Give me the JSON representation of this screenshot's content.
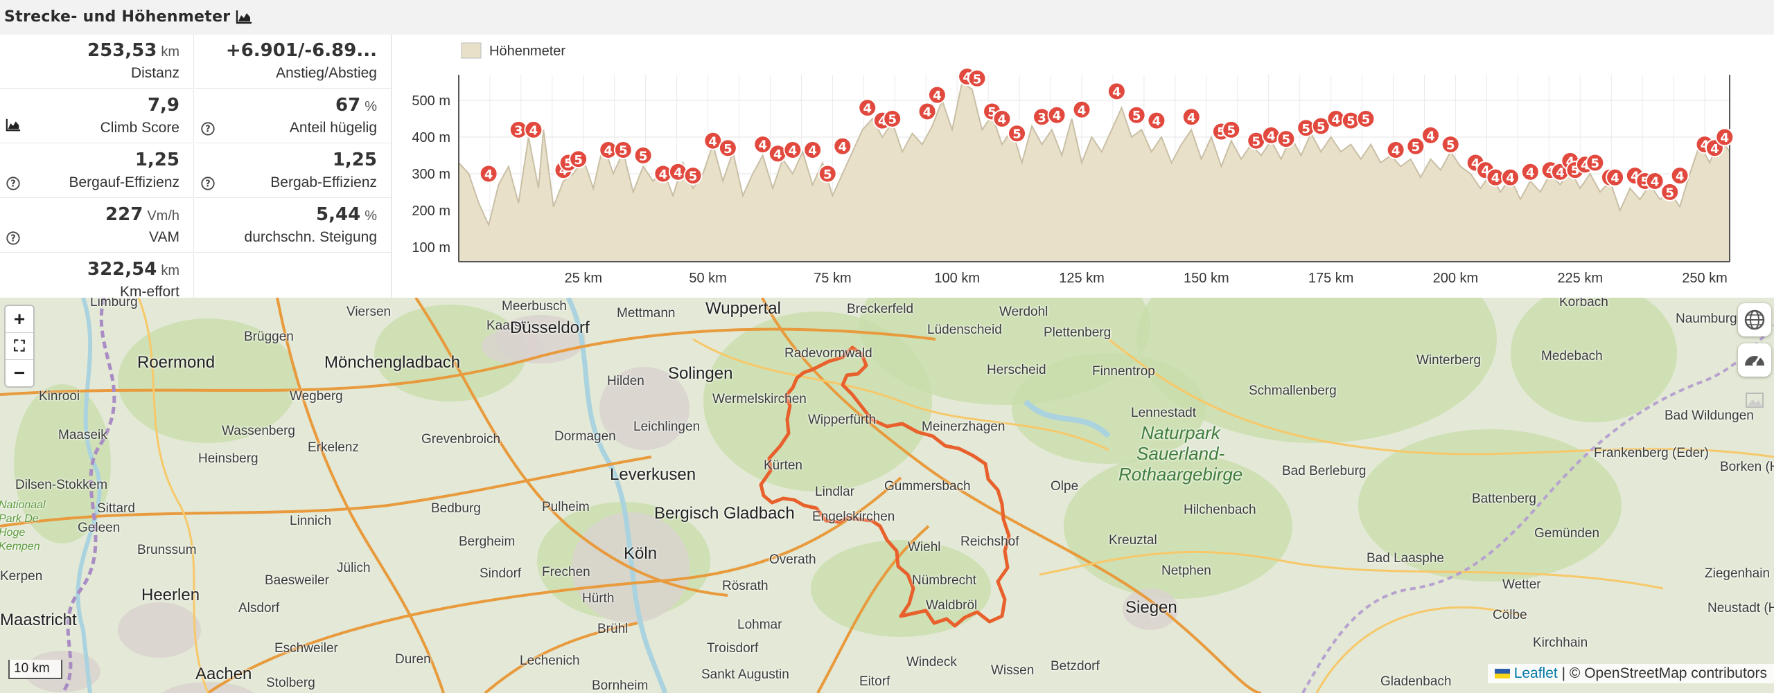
{
  "section_title": "Strecke- und Höhenmeter",
  "stats": [
    {
      "num": "253,53",
      "unit": "km",
      "label": "Distanz",
      "icon": ""
    },
    {
      "num": "+6.901/-6.89...",
      "unit": "",
      "label": "Anstieg/Abstieg",
      "icon": ""
    },
    {
      "num": "7,9",
      "unit": "",
      "label": "Climb Score",
      "icon": "chart-icon"
    },
    {
      "num": "67",
      "unit": "%",
      "label": "Anteil hügelig",
      "icon": "help-icon"
    },
    {
      "num": "1,25",
      "unit": "",
      "label": "Bergauf-Effizienz",
      "icon": "help-icon"
    },
    {
      "num": "1,25",
      "unit": "",
      "label": "Bergab-Effizienz",
      "icon": "help-icon"
    },
    {
      "num": "227",
      "unit": "Vm/h",
      "label": "VAM",
      "icon": "help-icon"
    },
    {
      "num": "5,44",
      "unit": "%",
      "label": "durchschn. Steigung",
      "icon": ""
    },
    {
      "num": "322,54",
      "unit": "km",
      "label": "Km-effort",
      "icon": ""
    }
  ],
  "chart_data": {
    "type": "area",
    "legend": "Höhenmeter",
    "legend_position": "top-left",
    "ylim": [
      60,
      570
    ],
    "xlim": [
      0,
      255
    ],
    "y_ticks": [
      100,
      200,
      300,
      400,
      500
    ],
    "y_tick_labels": [
      "100 m",
      "200 m",
      "300 m",
      "400 m",
      "500 m"
    ],
    "x_ticks": [
      25,
      50,
      75,
      100,
      125,
      150,
      175,
      200,
      225,
      250
    ],
    "x_tick_labels": [
      "25 km",
      "50 km",
      "75 km",
      "100 km",
      "125 km",
      "150 km",
      "175 km",
      "200 km",
      "225 km",
      "250 km"
    ],
    "grid": true,
    "fill_color": "#e8e0c9",
    "line_color": "#c9bfa5",
    "profile": [
      [
        0,
        330
      ],
      [
        2,
        300
      ],
      [
        4,
        220
      ],
      [
        6,
        160
      ],
      [
        8,
        270
      ],
      [
        10,
        320
      ],
      [
        12,
        220
      ],
      [
        14,
        400
      ],
      [
        16,
        260
      ],
      [
        17,
        420
      ],
      [
        19,
        210
      ],
      [
        21,
        280
      ],
      [
        23,
        300
      ],
      [
        25,
        340
      ],
      [
        27,
        260
      ],
      [
        29,
        380
      ],
      [
        31,
        300
      ],
      [
        33,
        360
      ],
      [
        35,
        250
      ],
      [
        37,
        320
      ],
      [
        39,
        280
      ],
      [
        41,
        310
      ],
      [
        43,
        240
      ],
      [
        45,
        330
      ],
      [
        47,
        260
      ],
      [
        49,
        300
      ],
      [
        51,
        380
      ],
      [
        53,
        280
      ],
      [
        55,
        360
      ],
      [
        57,
        240
      ],
      [
        59,
        300
      ],
      [
        61,
        350
      ],
      [
        63,
        260
      ],
      [
        65,
        340
      ],
      [
        67,
        300
      ],
      [
        69,
        360
      ],
      [
        71,
        270
      ],
      [
        73,
        330
      ],
      [
        75,
        240
      ],
      [
        77,
        300
      ],
      [
        79,
        360
      ],
      [
        81,
        420
      ],
      [
        83,
        450
      ],
      [
        85,
        400
      ],
      [
        87,
        440
      ],
      [
        89,
        360
      ],
      [
        91,
        410
      ],
      [
        93,
        380
      ],
      [
        95,
        430
      ],
      [
        97,
        500
      ],
      [
        99,
        420
      ],
      [
        101,
        550
      ],
      [
        103,
        530
      ],
      [
        105,
        420
      ],
      [
        107,
        460
      ],
      [
        109,
        380
      ],
      [
        111,
        420
      ],
      [
        113,
        330
      ],
      [
        115,
        430
      ],
      [
        117,
        380
      ],
      [
        119,
        420
      ],
      [
        121,
        350
      ],
      [
        123,
        450
      ],
      [
        125,
        330
      ],
      [
        127,
        400
      ],
      [
        129,
        360
      ],
      [
        131,
        420
      ],
      [
        133,
        480
      ],
      [
        135,
        400
      ],
      [
        137,
        420
      ],
      [
        139,
        360
      ],
      [
        141,
        400
      ],
      [
        143,
        330
      ],
      [
        145,
        380
      ],
      [
        147,
        420
      ],
      [
        149,
        340
      ],
      [
        151,
        400
      ],
      [
        153,
        320
      ],
      [
        155,
        390
      ],
      [
        157,
        340
      ],
      [
        159,
        380
      ],
      [
        161,
        350
      ],
      [
        163,
        390
      ],
      [
        165,
        340
      ],
      [
        167,
        400
      ],
      [
        169,
        350
      ],
      [
        171,
        410
      ],
      [
        173,
        360
      ],
      [
        175,
        400
      ],
      [
        177,
        360
      ],
      [
        179,
        380
      ],
      [
        181,
        340
      ],
      [
        183,
        380
      ],
      [
        185,
        330
      ],
      [
        187,
        350
      ],
      [
        189,
        320
      ],
      [
        191,
        340
      ],
      [
        193,
        290
      ],
      [
        195,
        340
      ],
      [
        197,
        310
      ],
      [
        199,
        360
      ],
      [
        201,
        320
      ],
      [
        203,
        300
      ],
      [
        205,
        260
      ],
      [
        207,
        300
      ],
      [
        209,
        250
      ],
      [
        211,
        290
      ],
      [
        213,
        230
      ],
      [
        215,
        280
      ],
      [
        217,
        250
      ],
      [
        219,
        300
      ],
      [
        221,
        270
      ],
      [
        223,
        310
      ],
      [
        225,
        260
      ],
      [
        227,
        300
      ],
      [
        229,
        250
      ],
      [
        231,
        280
      ],
      [
        233,
        200
      ],
      [
        235,
        260
      ],
      [
        237,
        230
      ],
      [
        239,
        270
      ],
      [
        241,
        230
      ],
      [
        243,
        250
      ],
      [
        245,
        210
      ],
      [
        247,
        300
      ],
      [
        249,
        380
      ],
      [
        251,
        330
      ],
      [
        253,
        400
      ],
      [
        255,
        360
      ]
    ],
    "markers": [
      {
        "x": 6,
        "y": 300,
        "label": "4"
      },
      {
        "x": 12,
        "y": 420,
        "label": "3"
      },
      {
        "x": 15,
        "y": 420,
        "label": "4"
      },
      {
        "x": 21,
        "y": 310,
        "label": "4"
      },
      {
        "x": 22,
        "y": 330,
        "label": "5"
      },
      {
        "x": 24,
        "y": 340,
        "label": "5"
      },
      {
        "x": 30,
        "y": 365,
        "label": "4"
      },
      {
        "x": 33,
        "y": 365,
        "label": "5"
      },
      {
        "x": 37,
        "y": 350,
        "label": "5"
      },
      {
        "x": 41,
        "y": 300,
        "label": "4"
      },
      {
        "x": 44,
        "y": 305,
        "label": "4"
      },
      {
        "x": 47,
        "y": 295,
        "label": "5"
      },
      {
        "x": 51,
        "y": 390,
        "label": "4"
      },
      {
        "x": 54,
        "y": 370,
        "label": "5"
      },
      {
        "x": 61,
        "y": 380,
        "label": "4"
      },
      {
        "x": 64,
        "y": 355,
        "label": "4"
      },
      {
        "x": 67,
        "y": 365,
        "label": "4"
      },
      {
        "x": 71,
        "y": 365,
        "label": "4"
      },
      {
        "x": 74,
        "y": 300,
        "label": "5"
      },
      {
        "x": 77,
        "y": 375,
        "label": "4"
      },
      {
        "x": 82,
        "y": 480,
        "label": "4"
      },
      {
        "x": 85,
        "y": 445,
        "label": "4"
      },
      {
        "x": 87,
        "y": 450,
        "label": "5"
      },
      {
        "x": 94,
        "y": 470,
        "label": "4"
      },
      {
        "x": 96,
        "y": 515,
        "label": "4"
      },
      {
        "x": 102,
        "y": 565,
        "label": "4"
      },
      {
        "x": 104,
        "y": 560,
        "label": "5"
      },
      {
        "x": 107,
        "y": 470,
        "label": "5"
      },
      {
        "x": 109,
        "y": 450,
        "label": "4"
      },
      {
        "x": 112,
        "y": 410,
        "label": "5"
      },
      {
        "x": 117,
        "y": 455,
        "label": "3"
      },
      {
        "x": 120,
        "y": 460,
        "label": "4"
      },
      {
        "x": 125,
        "y": 475,
        "label": "4"
      },
      {
        "x": 132,
        "y": 525,
        "label": "4"
      },
      {
        "x": 136,
        "y": 460,
        "label": "5"
      },
      {
        "x": 140,
        "y": 445,
        "label": "4"
      },
      {
        "x": 147,
        "y": 455,
        "label": "4"
      },
      {
        "x": 153,
        "y": 415,
        "label": "5"
      },
      {
        "x": 155,
        "y": 420,
        "label": "5"
      },
      {
        "x": 160,
        "y": 390,
        "label": "5"
      },
      {
        "x": 163,
        "y": 405,
        "label": "4"
      },
      {
        "x": 166,
        "y": 395,
        "label": "5"
      },
      {
        "x": 170,
        "y": 425,
        "label": "5"
      },
      {
        "x": 173,
        "y": 430,
        "label": "5"
      },
      {
        "x": 176,
        "y": 450,
        "label": "4"
      },
      {
        "x": 179,
        "y": 445,
        "label": "5"
      },
      {
        "x": 182,
        "y": 450,
        "label": "5"
      },
      {
        "x": 188,
        "y": 365,
        "label": "4"
      },
      {
        "x": 192,
        "y": 375,
        "label": "5"
      },
      {
        "x": 195,
        "y": 405,
        "label": "4"
      },
      {
        "x": 199,
        "y": 380,
        "label": "5"
      },
      {
        "x": 204,
        "y": 330,
        "label": "4"
      },
      {
        "x": 206,
        "y": 310,
        "label": "4"
      },
      {
        "x": 208,
        "y": 290,
        "label": "4"
      },
      {
        "x": 211,
        "y": 290,
        "label": "4"
      },
      {
        "x": 215,
        "y": 305,
        "label": "4"
      },
      {
        "x": 219,
        "y": 310,
        "label": "4"
      },
      {
        "x": 221,
        "y": 305,
        "label": "4"
      },
      {
        "x": 223,
        "y": 335,
        "label": "4"
      },
      {
        "x": 224,
        "y": 310,
        "label": "5"
      },
      {
        "x": 226,
        "y": 325,
        "label": "4"
      },
      {
        "x": 228,
        "y": 330,
        "label": "5"
      },
      {
        "x": 231,
        "y": 290,
        "label": "4"
      },
      {
        "x": 232,
        "y": 290,
        "label": "4"
      },
      {
        "x": 236,
        "y": 295,
        "label": "4"
      },
      {
        "x": 238,
        "y": 280,
        "label": "5"
      },
      {
        "x": 240,
        "y": 280,
        "label": "4"
      },
      {
        "x": 243,
        "y": 250,
        "label": "5"
      },
      {
        "x": 245,
        "y": 295,
        "label": "4"
      },
      {
        "x": 250,
        "y": 380,
        "label": "4"
      },
      {
        "x": 252,
        "y": 370,
        "label": "4"
      },
      {
        "x": 254,
        "y": 400,
        "label": "4"
      }
    ]
  },
  "map": {
    "places": [
      {
        "name": "Limburg",
        "cls": ""
      },
      {
        "name": "Viersen",
        "cls": ""
      },
      {
        "name": "Meerbusch",
        "cls": ""
      },
      {
        "name": "Mettmann",
        "cls": ""
      },
      {
        "name": "Wuppertal",
        "cls": "big"
      },
      {
        "name": "Breckerfeld",
        "cls": ""
      },
      {
        "name": "Werdohl",
        "cls": ""
      },
      {
        "name": "Korbach",
        "cls": ""
      },
      {
        "name": "Brüggen",
        "cls": ""
      },
      {
        "name": "Kaarst",
        "cls": ""
      },
      {
        "name": "Düsseldorf",
        "cls": "big"
      },
      {
        "name": "Lüdenscheid",
        "cls": ""
      },
      {
        "name": "Plettenberg",
        "cls": ""
      },
      {
        "name": "Naumburg",
        "cls": ""
      },
      {
        "name": "Roermond",
        "cls": "big"
      },
      {
        "name": "Mönchengladbach",
        "cls": "big"
      },
      {
        "name": "Solingen",
        "cls": "big"
      },
      {
        "name": "Radevormwald",
        "cls": ""
      },
      {
        "name": "Herscheid",
        "cls": ""
      },
      {
        "name": "Finnentrop",
        "cls": ""
      },
      {
        "name": "Winterberg",
        "cls": ""
      },
      {
        "name": "Medebach",
        "cls": ""
      },
      {
        "name": "Kinrooi",
        "cls": ""
      },
      {
        "name": "Wegberg",
        "cls": ""
      },
      {
        "name": "Hilden",
        "cls": ""
      },
      {
        "name": "Wermelskirchen",
        "cls": ""
      },
      {
        "name": "Schmallenberg",
        "cls": ""
      },
      {
        "name": "Maaseik",
        "cls": ""
      },
      {
        "name": "Wassenberg",
        "cls": ""
      },
      {
        "name": "Grevenbroich",
        "cls": ""
      },
      {
        "name": "Dormagen",
        "cls": ""
      },
      {
        "name": "Leichlingen",
        "cls": ""
      },
      {
        "name": "Wipperfürth",
        "cls": ""
      },
      {
        "name": "Meinerzhagen",
        "cls": ""
      },
      {
        "name": "Lennestadt",
        "cls": ""
      },
      {
        "name": "Bad Wildungen",
        "cls": ""
      },
      {
        "name": "Heinsberg",
        "cls": ""
      },
      {
        "name": "Erkelenz",
        "cls": ""
      },
      {
        "name": "Frankenberg (Eder)",
        "cls": ""
      },
      {
        "name": "Dilsen-Stokkem",
        "cls": ""
      },
      {
        "name": "Leverkusen",
        "cls": "big"
      },
      {
        "name": "Kürten",
        "cls": ""
      },
      {
        "name": "Lindlar",
        "cls": ""
      },
      {
        "name": "Gummersbach",
        "cls": ""
      },
      {
        "name": "Olpe",
        "cls": ""
      },
      {
        "name": "Bad Berleburg",
        "cls": ""
      },
      {
        "name": "Borken (Hesse)",
        "cls": ""
      },
      {
        "name": "Sittard",
        "cls": ""
      },
      {
        "name": "Linnich",
        "cls": ""
      },
      {
        "name": "Bedburg",
        "cls": ""
      },
      {
        "name": "Pulheim",
        "cls": ""
      },
      {
        "name": "Bergisch Gladbach",
        "cls": "big"
      },
      {
        "name": "Engelskirchen",
        "cls": ""
      },
      {
        "name": "Hilchenbach",
        "cls": ""
      },
      {
        "name": "Battenberg",
        "cls": ""
      },
      {
        "name": "Geleen",
        "cls": ""
      },
      {
        "name": "Brunssum",
        "cls": ""
      },
      {
        "name": "Bergheim",
        "cls": ""
      },
      {
        "name": "Köln",
        "cls": "big"
      },
      {
        "name": "Wiehl",
        "cls": ""
      },
      {
        "name": "Reichshof",
        "cls": ""
      },
      {
        "name": "Kreuztal",
        "cls": ""
      },
      {
        "name": "Gemünden",
        "cls": ""
      },
      {
        "name": "Jülich",
        "cls": ""
      },
      {
        "name": "Overath",
        "cls": ""
      },
      {
        "name": "Bad Laasphe",
        "cls": ""
      },
      {
        "name": "Kerpen",
        "cls": ""
      },
      {
        "name": "Frechen",
        "cls": ""
      },
      {
        "name": "Netphen",
        "cls": ""
      },
      {
        "name": "Heerlen",
        "cls": "big"
      },
      {
        "name": "Baesweiler",
        "cls": ""
      },
      {
        "name": "Sindorf",
        "cls": ""
      },
      {
        "name": "Hürth",
        "cls": ""
      },
      {
        "name": "Rösrath",
        "cls": ""
      },
      {
        "name": "Nümbrecht",
        "cls": ""
      },
      {
        "name": "Wetter",
        "cls": ""
      },
      {
        "name": "Ziegenhain",
        "cls": ""
      },
      {
        "name": "Alsdorf",
        "cls": ""
      },
      {
        "name": "Waldbröl",
        "cls": ""
      },
      {
        "name": "Siegen",
        "cls": "big"
      },
      {
        "name": "Maastricht",
        "cls": "big"
      },
      {
        "name": "Brühl",
        "cls": ""
      },
      {
        "name": "Lohmar",
        "cls": ""
      },
      {
        "name": "Cölbe",
        "cls": ""
      },
      {
        "name": "Neustadt (Hessen)",
        "cls": ""
      },
      {
        "name": "Eschweiler",
        "cls": ""
      },
      {
        "name": "Troisdorf",
        "cls": ""
      },
      {
        "name": "Kirchhain",
        "cls": ""
      },
      {
        "name": "Duren",
        "cls": ""
      },
      {
        "name": "Lechenich",
        "cls": ""
      },
      {
        "name": "Windeck",
        "cls": ""
      },
      {
        "name": "Aachen",
        "cls": "big"
      },
      {
        "name": "Stolberg",
        "cls": ""
      },
      {
        "name": "Sankt Augustin",
        "cls": ""
      },
      {
        "name": "Eitorf",
        "cls": ""
      },
      {
        "name": "Wissen",
        "cls": ""
      },
      {
        "name": "Betzdorf",
        "cls": ""
      },
      {
        "name": "Gladenbach",
        "cls": ""
      },
      {
        "name": "Bornheim",
        "cls": ""
      },
      {
        "name": "Naturpark Sauerland-Rothaargebirge",
        "cls": "park"
      },
      {
        "name": "Nationaal Park De Hoge Kempen",
        "cls": "park-small"
      }
    ],
    "zoom_in": "+",
    "fullscreen": "⛶",
    "zoom_out": "−",
    "scale_label": "10 km",
    "attribution_leaflet": "Leaflet",
    "attribution_osm": "| © OpenStreetMap contributors",
    "route_color": "#e8602c"
  }
}
